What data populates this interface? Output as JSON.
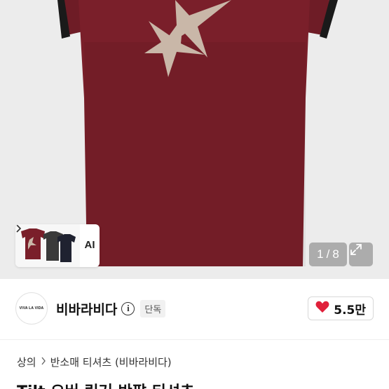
{
  "gallery": {
    "thumbnail_side_label": "AI",
    "page_current": "1",
    "page_separator": "/",
    "page_total": "8",
    "shirt_color": "#7a1f2a",
    "star_color": "#c9b7a8"
  },
  "seller": {
    "avatar_text": "VIVA LA VIDA",
    "name": "비바라비다",
    "badge": "단독",
    "likes": "5.5만",
    "heart_color": "#e0203a"
  },
  "breadcrumb": {
    "items": [
      "상의",
      "반소매 티셔츠 (비바라비다)"
    ]
  },
  "product": {
    "title": "Tilt 오버 링거 반팔 티셔츠"
  }
}
